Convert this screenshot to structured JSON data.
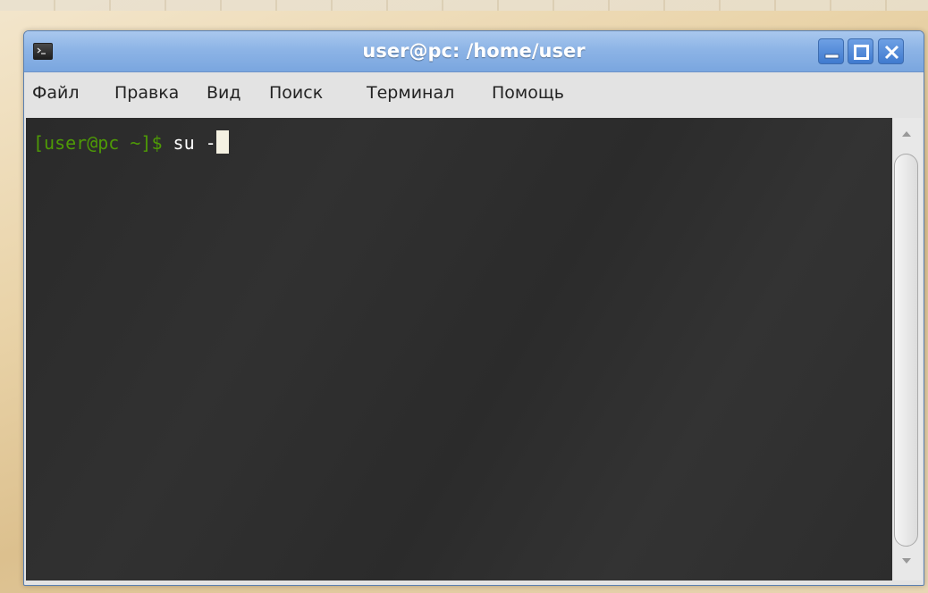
{
  "window": {
    "title": "user@pc: /home/user"
  },
  "menubar": {
    "items": [
      "Файл",
      "Правка",
      "Вид",
      "Поиск",
      "Терминал",
      "Помощь"
    ]
  },
  "terminal": {
    "prompt": "[user@pc ~]$",
    "command": " su -"
  },
  "icons": {
    "app": "terminal-icon",
    "minimize": "minimize-icon",
    "maximize": "maximize-icon",
    "close": "close-icon",
    "scroll_up": "arrow-up-icon",
    "scroll_down": "arrow-down-icon"
  },
  "colors": {
    "titlebar": "#8db4e6",
    "terminal_bg": "#2e2e2e",
    "prompt": "#4e9a06",
    "cursor": "#f4f1e2"
  }
}
